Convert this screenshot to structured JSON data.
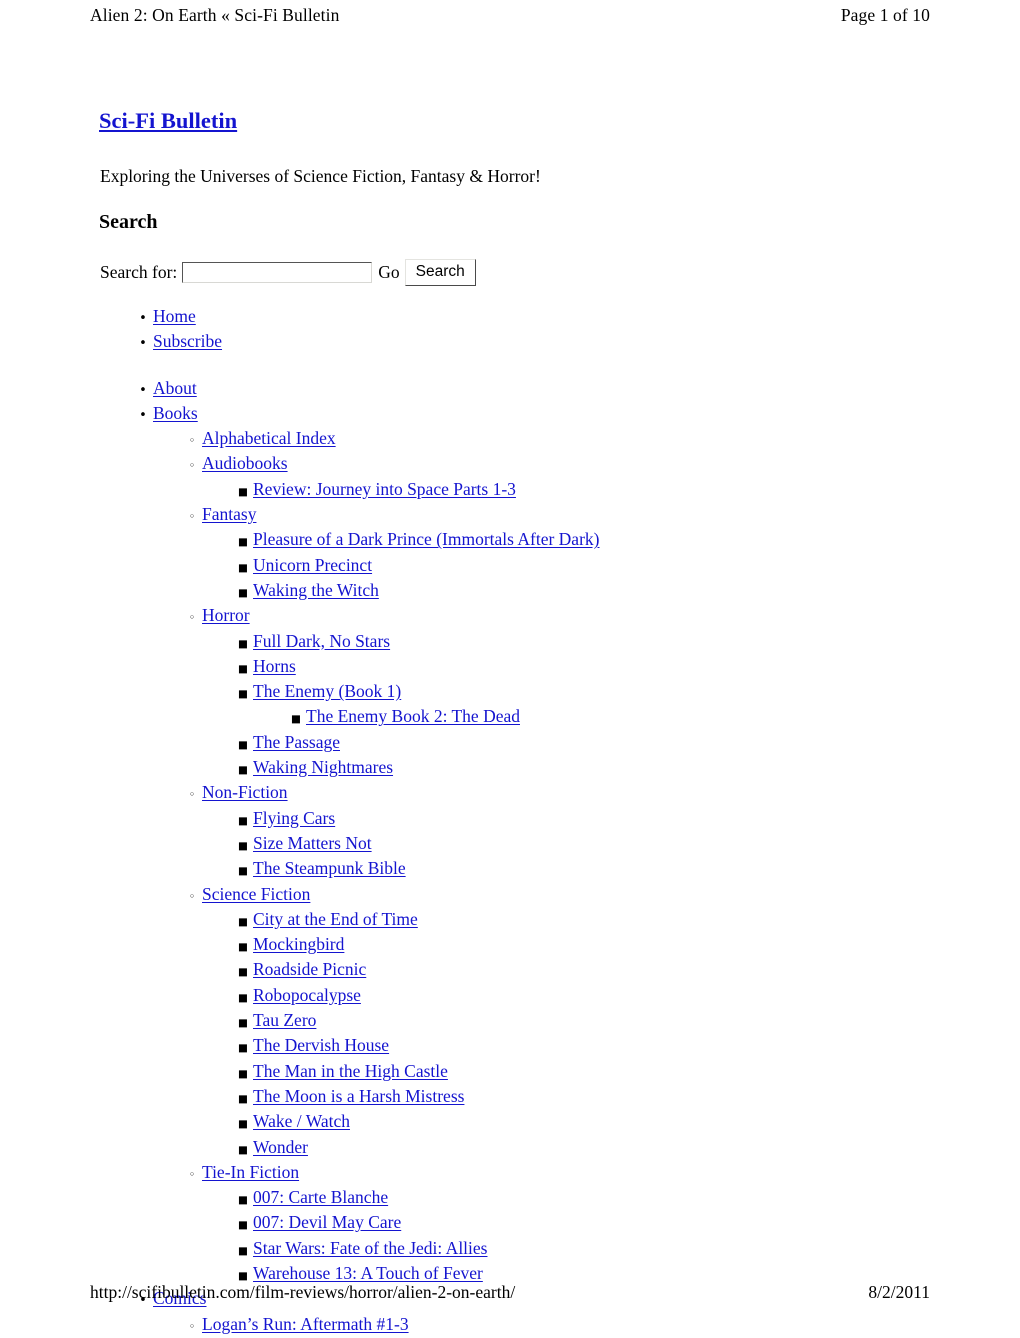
{
  "page_header": {
    "left_title": "Alien 2: On Earth « Sci-Fi Bulletin",
    "right_pagination": "Page 1 of 10"
  },
  "page_footer": {
    "url": "http://scifibulletin.com/film-reviews/horror/alien-2-on-earth/",
    "date": "8/2/2011"
  },
  "site": {
    "title": "Sci-Fi Bulletin",
    "tagline": "Exploring the Universes of Science Fiction, Fantasy & Horror!"
  },
  "search": {
    "heading": "Search",
    "label": "Search for:",
    "input_value": "",
    "input_placeholder": "",
    "go_text": "Go",
    "button_label": "Search"
  },
  "colors": {
    "link": "#1414cf",
    "text": "#000000",
    "background": "#ffffff"
  },
  "nav": {
    "group_one": [
      {
        "label": "Home",
        "level": 1,
        "marker": "disc"
      },
      {
        "label": "Subscribe",
        "level": 1,
        "marker": "disc"
      }
    ],
    "group_two": [
      {
        "label": "About",
        "level": 1,
        "marker": "disc"
      },
      {
        "label": "Books",
        "level": 1,
        "marker": "disc"
      },
      {
        "label": "Alphabetical Index",
        "level": 2,
        "marker": "circle"
      },
      {
        "label": "Audiobooks",
        "level": 2,
        "marker": "circle"
      },
      {
        "label": "Review: Journey into Space Parts 1-3",
        "level": 3,
        "marker": "square"
      },
      {
        "label": "Fantasy",
        "level": 2,
        "marker": "circle"
      },
      {
        "label": "Pleasure of a Dark Prince (Immortals After Dark)",
        "level": 3,
        "marker": "square"
      },
      {
        "label": "Unicorn Precinct",
        "level": 3,
        "marker": "square"
      },
      {
        "label": "Waking the Witch",
        "level": 3,
        "marker": "square"
      },
      {
        "label": "Horror",
        "level": 2,
        "marker": "circle"
      },
      {
        "label": "Full Dark, No Stars",
        "level": 3,
        "marker": "square"
      },
      {
        "label": "Horns",
        "level": 3,
        "marker": "square"
      },
      {
        "label": "The Enemy (Book 1)",
        "level": 3,
        "marker": "square"
      },
      {
        "label": "The Enemy Book 2: The Dead",
        "level": 4,
        "marker": "square"
      },
      {
        "label": "The Passage",
        "level": 3,
        "marker": "square"
      },
      {
        "label": "Waking Nightmares",
        "level": 3,
        "marker": "square"
      },
      {
        "label": "Non-Fiction",
        "level": 2,
        "marker": "circle"
      },
      {
        "label": "Flying Cars",
        "level": 3,
        "marker": "square"
      },
      {
        "label": "Size Matters Not",
        "level": 3,
        "marker": "square"
      },
      {
        "label": "The Steampunk Bible",
        "level": 3,
        "marker": "square"
      },
      {
        "label": "Science Fiction",
        "level": 2,
        "marker": "circle"
      },
      {
        "label": "City at the End of Time",
        "level": 3,
        "marker": "square"
      },
      {
        "label": "Mockingbird",
        "level": 3,
        "marker": "square"
      },
      {
        "label": "Roadside Picnic",
        "level": 3,
        "marker": "square"
      },
      {
        "label": "Robopocalypse",
        "level": 3,
        "marker": "square"
      },
      {
        "label": "Tau Zero",
        "level": 3,
        "marker": "square"
      },
      {
        "label": "The Dervish House",
        "level": 3,
        "marker": "square"
      },
      {
        "label": "The Man in the High Castle",
        "level": 3,
        "marker": "square"
      },
      {
        "label": "The Moon is a Harsh Mistress",
        "level": 3,
        "marker": "square"
      },
      {
        "label": "Wake / Watch",
        "level": 3,
        "marker": "square"
      },
      {
        "label": "Wonder",
        "level": 3,
        "marker": "square"
      },
      {
        "label": "Tie-In Fiction",
        "level": 2,
        "marker": "circle"
      },
      {
        "label": "007: Carte Blanche",
        "level": 3,
        "marker": "square"
      },
      {
        "label": "007: Devil May Care",
        "level": 3,
        "marker": "square"
      },
      {
        "label": "Star Wars: Fate of the Jedi: Allies",
        "level": 3,
        "marker": "square"
      },
      {
        "label": "Warehouse 13: A Touch of Fever",
        "level": 3,
        "marker": "square"
      },
      {
        "label": "Comics",
        "level": 1,
        "marker": "disc"
      },
      {
        "label": "Logan’s Run: Aftermath #1-3",
        "level": 2,
        "marker": "circle"
      }
    ]
  }
}
